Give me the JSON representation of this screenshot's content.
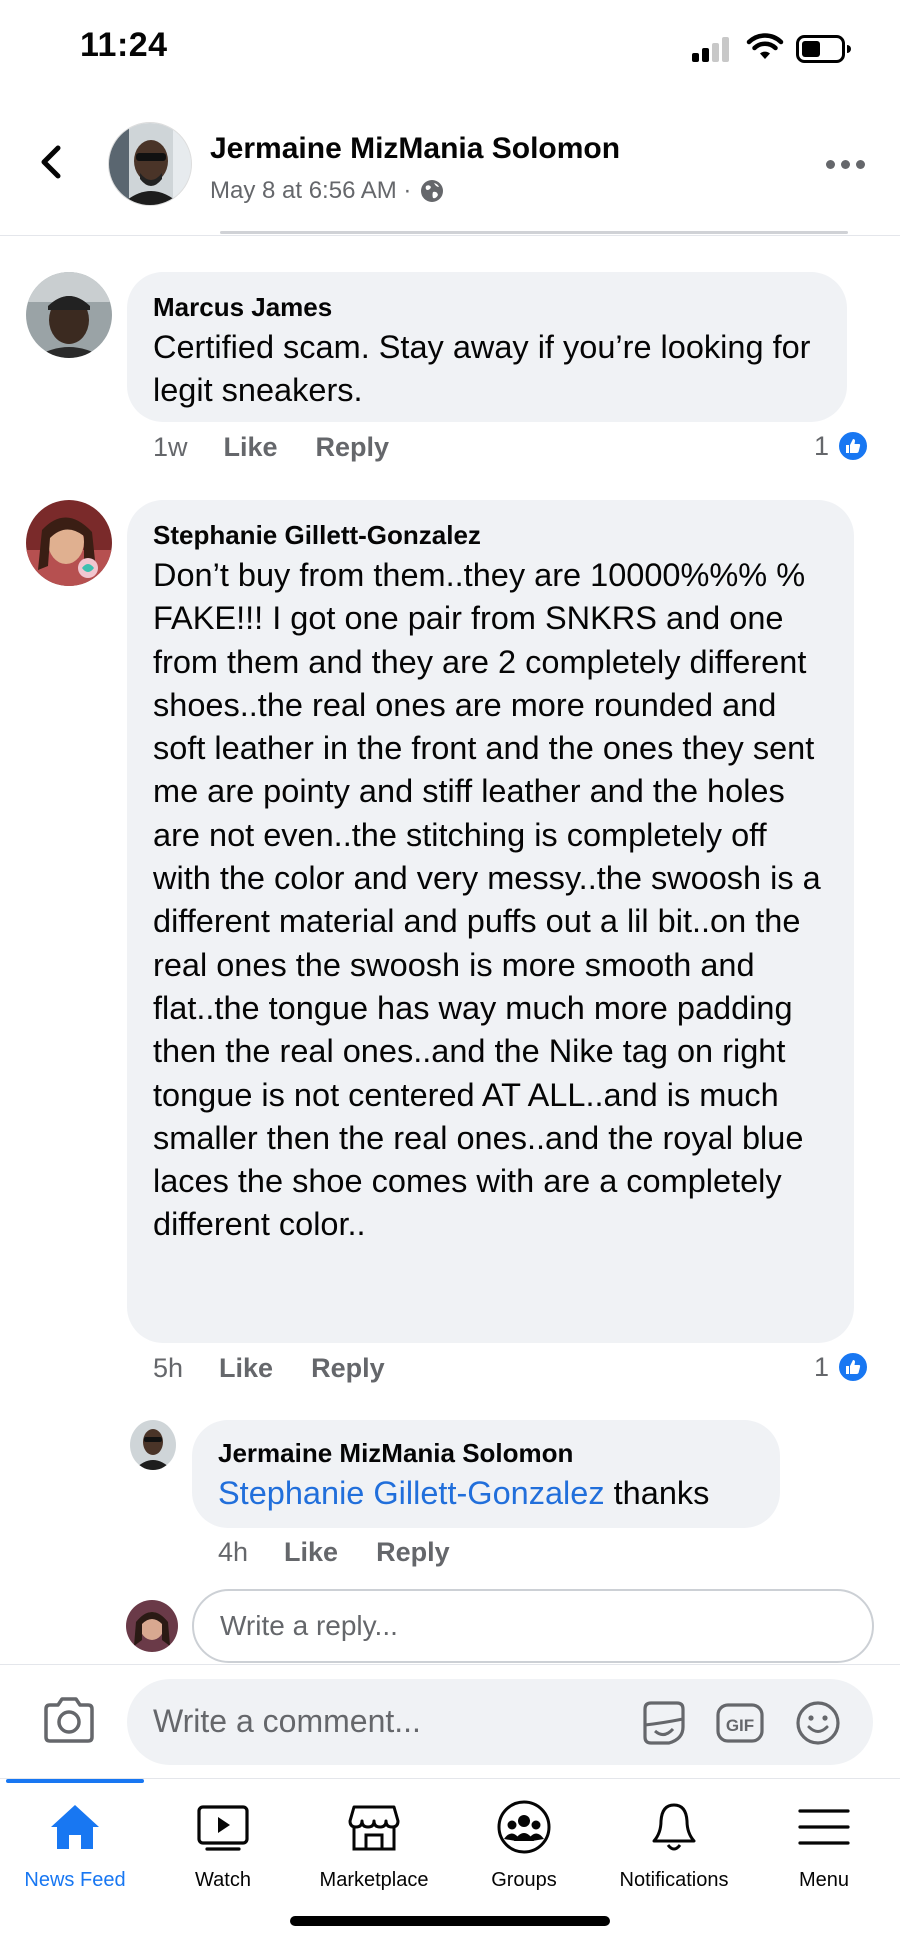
{
  "status_bar": {
    "time": "11:24"
  },
  "header": {
    "author_name": "Jermaine MizMania Solomon",
    "post_meta": "May 8 at 6:56 AM ·",
    "privacy_icon": "globe-icon"
  },
  "comments": [
    {
      "author": "Marcus James",
      "text": "Certified scam. Stay away if you’re looking for legit sneakers.",
      "time": "1w",
      "like_label": "Like",
      "reply_label": "Reply",
      "reaction_count": "1"
    },
    {
      "author": "Stephanie Gillett-Gonzalez",
      "text": "Don’t buy from them..they are 10000%%% % FAKE!!! I got one pair from SNKRS and one from them and they are 2 completely different shoes..the real ones are more rounded and soft leather in the front and the ones they sent me are pointy and stiff leather and the holes are not even..the stitching is completely off with the color and very messy..the swoosh is a different material and puffs out a lil bit..on the real ones the swoosh is more smooth and flat..the tongue has way much more padding then the real ones..and the Nike tag on right tongue is not centered AT ALL..and is much smaller then the real ones..and the royal blue laces the shoe comes with are a completely different color..",
      "time": "5h",
      "like_label": "Like",
      "reply_label": "Reply",
      "reaction_count": "1"
    }
  ],
  "reply": {
    "author": "Jermaine MizMania Solomon",
    "mention": "Stephanie Gillett-Gonzalez",
    "text": "thanks",
    "time": "4h",
    "like_label": "Like",
    "reply_label": "Reply"
  },
  "reply_input": {
    "placeholder": "Write a reply..."
  },
  "composer": {
    "placeholder": "Write a comment..."
  },
  "tabs": [
    {
      "label": "News Feed",
      "icon": "home-icon",
      "active": true
    },
    {
      "label": "Watch",
      "icon": "watch-icon",
      "active": false
    },
    {
      "label": "Marketplace",
      "icon": "marketplace-icon",
      "active": false
    },
    {
      "label": "Groups",
      "icon": "groups-icon",
      "active": false
    },
    {
      "label": "Notifications",
      "icon": "bell-icon",
      "active": false
    },
    {
      "label": "Menu",
      "icon": "menu-icon",
      "active": false
    }
  ],
  "colors": {
    "accent": "#1877f2",
    "mention": "#216fdb",
    "bubble": "#f0f2f5",
    "secondary_text": "#65676b"
  }
}
